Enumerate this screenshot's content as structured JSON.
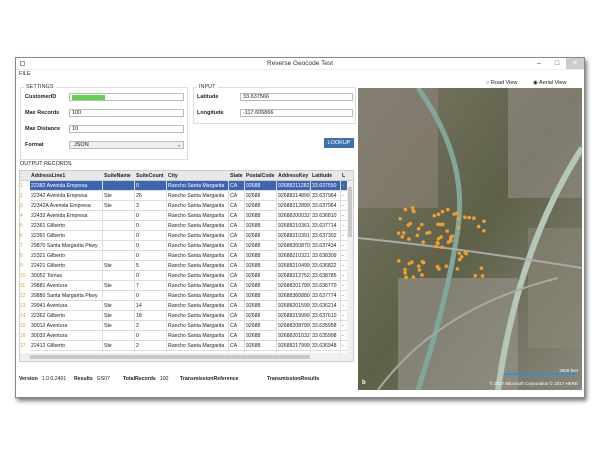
{
  "window": {
    "title": "Reverse Geocode Test",
    "menu": [
      "FILE"
    ]
  },
  "settings": {
    "legend": "SETTINGS",
    "customer_id_label": "CustomerID",
    "customer_id_value": "",
    "max_records_label": "Max Records",
    "max_records_value": "100",
    "max_distance_label": "Max Distance",
    "max_distance_value": "10",
    "format_label": "Format",
    "format_value": "JSON"
  },
  "input": {
    "legend": "INPUT",
    "latitude_label": "Latitude",
    "latitude_value": "33.637566",
    "longitude_label": "Longitude",
    "longitude_value": "-117.606866",
    "lookup_label": "LOOKUP"
  },
  "map": {
    "road_view": "Road View",
    "aerial_view": "Aerial View",
    "selected": "Aerial View",
    "scale": "2500 feet",
    "copyright": "© 2017 Microsoft Corporation  © 2017 HERE",
    "logo": "bing"
  },
  "output": {
    "legend": "OUTPUT RECORDS",
    "columns": [
      "AddressLine1",
      "SuiteName",
      "SuiteCount",
      "City",
      "State",
      "PostalCode",
      "AddressKey",
      "Latitude",
      "L"
    ],
    "rows": [
      [
        "22382 Avenida Empresa",
        "",
        "0",
        "Rancho Santa Margarita",
        "CA",
        "92688",
        "92688211282",
        "33.637550",
        "-"
      ],
      [
        "22342 Avenida Empresa",
        "Ste",
        "26",
        "Rancho Santa Margarita",
        "CA",
        "92688",
        "92688214899",
        "33.637964",
        "-"
      ],
      [
        "22342A Avenida Empresa",
        "Ste",
        "3",
        "Rancho Santa Margarita",
        "CA",
        "92688",
        "92688212899",
        "33.637964",
        "-"
      ],
      [
        "22432 Avenida Empresa",
        "",
        "0",
        "Rancho Santa Margarita",
        "CA",
        "92688",
        "92688200032",
        "33.636810",
        "-"
      ],
      [
        "22361 Gilberto",
        "",
        "0",
        "Rancho Santa Margarita",
        "CA",
        "92688",
        "92688210361",
        "33.637714",
        "-"
      ],
      [
        "22391 Gilberto",
        "",
        "0",
        "Rancho Santa Margarita",
        "CA",
        "92688",
        "92688210391",
        "33.637302",
        "-"
      ],
      [
        "29870 Santa Margarita Pkwy",
        "",
        "0",
        "Rancho Santa Margarita",
        "CA",
        "92688",
        "92688360870",
        "33.637434",
        "-"
      ],
      [
        "22321 Gilberto",
        "",
        "0",
        "Rancho Santa Margarita",
        "CA",
        "92688",
        "92688210321",
        "33.638309",
        "-"
      ],
      [
        "22421 Gilberto",
        "Ste",
        "5",
        "Rancho Santa Margarita",
        "CA",
        "92688",
        "92688210499",
        "33.636822",
        "-"
      ],
      [
        "30052 Tomas",
        "",
        "0",
        "Rancho Santa Margarita",
        "CA",
        "92688",
        "92688212752",
        "33.638785",
        "-"
      ],
      [
        "29881 Aventura",
        "Ste",
        "7",
        "Rancho Santa Margarita",
        "CA",
        "92688",
        "92688201799",
        "33.636770",
        "-"
      ],
      [
        "29880 Santa Margarita Pkwy",
        "",
        "0",
        "Rancho Santa Margarita",
        "CA",
        "92688",
        "92688360880",
        "33.637774",
        "-"
      ],
      [
        "29941 Aventura",
        "Ste",
        "14",
        "Rancho Santa Margarita",
        "CA",
        "92688",
        "92688201599",
        "33.636214",
        "-"
      ],
      [
        "22362 Gilberto",
        "Ste",
        "18",
        "Rancho Santa Margarita",
        "CA",
        "92688",
        "92688219999",
        "33.637610",
        "-"
      ],
      [
        "30012 Aventura",
        "Ste",
        "2",
        "Rancho Santa Margarita",
        "CA",
        "92688",
        "92688208799",
        "33.635958",
        "-"
      ],
      [
        "30032 Aventura",
        "",
        "0",
        "Rancho Santa Margarita",
        "CA",
        "92688",
        "92688201032",
        "33.635998",
        "-"
      ],
      [
        "22412 Gilberto",
        "Ste",
        "2",
        "Rancho Santa Margarita",
        "CA",
        "92688",
        "92688217999",
        "33.636948",
        "-"
      ],
      [
        "30062 Aventura",
        "",
        "0",
        "Rancho Santa Margarita",
        "CA",
        "92688",
        "92688201062",
        "33.636424",
        "-"
      ]
    ]
  },
  "status": {
    "version_label": "Version",
    "version_value": "1.0.0.2401",
    "results_label": "Results",
    "results_value": "GS07",
    "total_label": "TotalRecords",
    "total_value": "100",
    "transref_label": "TransmissionReference",
    "transref_value": "",
    "transres_label": "TransmissionResults",
    "transres_value": ""
  },
  "colors": {
    "accent": "#3e6fb3",
    "row_number": "#e69a1a",
    "map_marker": "#f0a030"
  }
}
